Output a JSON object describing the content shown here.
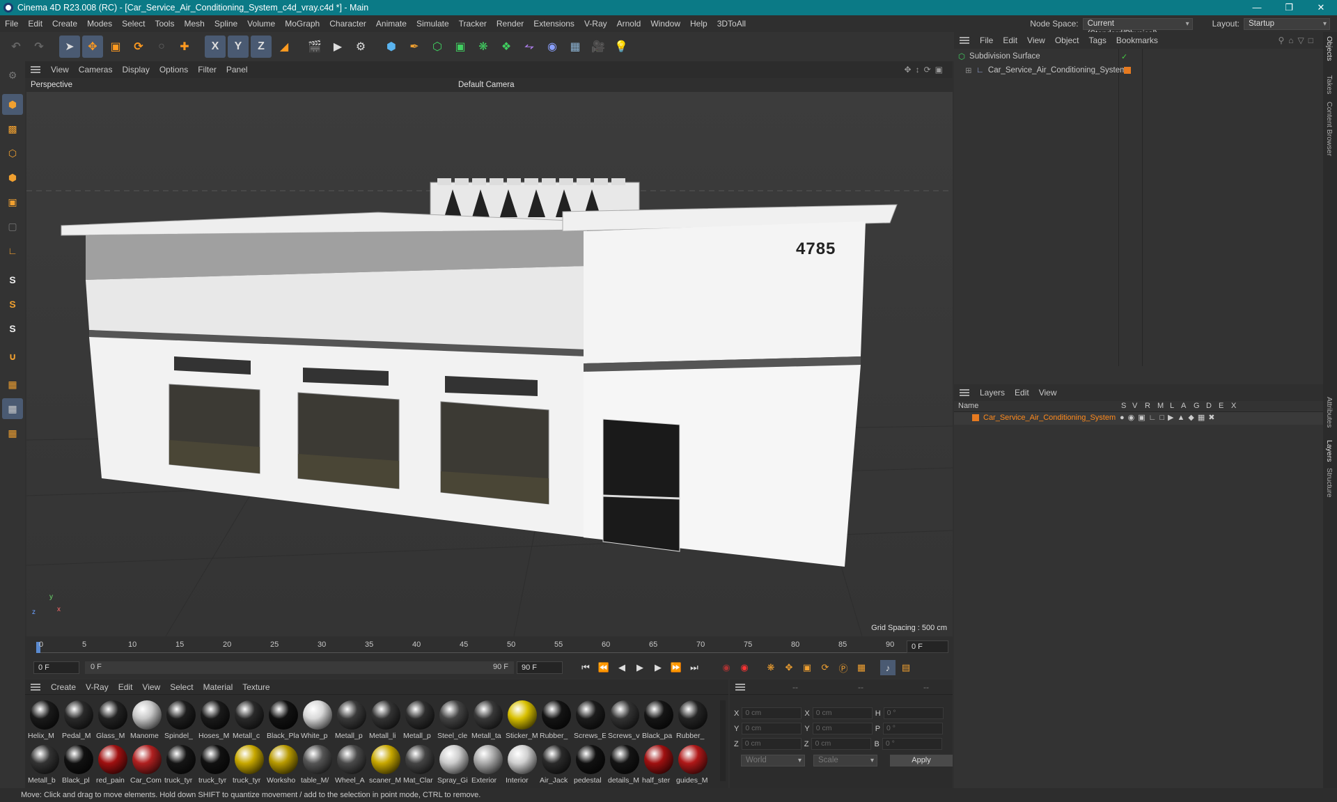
{
  "window": {
    "title": "Cinema 4D R23.008 (RC) - [Car_Service_Air_Conditioning_System_c4d_vray.c4d *] - Main"
  },
  "menubar": {
    "items": [
      "File",
      "Edit",
      "Create",
      "Modes",
      "Select",
      "Tools",
      "Mesh",
      "Spline",
      "Volume",
      "MoGraph",
      "Character",
      "Animate",
      "Simulate",
      "Tracker",
      "Render",
      "Extensions",
      "V-Ray",
      "Arnold",
      "Window",
      "Help",
      "3DToAll"
    ],
    "node_space_label": "Node Space:",
    "node_space_value": "Current (Standard/Physical)",
    "layout_label": "Layout:",
    "layout_value": "Startup"
  },
  "toolbar": {
    "axis_x": "X",
    "axis_y": "Y",
    "axis_z": "Z"
  },
  "left_tools": {
    "s1": "S",
    "s2": "S",
    "s3": "S"
  },
  "viewport": {
    "menu": [
      "View",
      "Cameras",
      "Display",
      "Options",
      "Filter",
      "Panel"
    ],
    "view_name": "Perspective",
    "camera": "Default Camera",
    "grid_spacing": "Grid Spacing : 500 cm",
    "building_number": "4785",
    "axis_y": "y",
    "axis_z": "z",
    "axis_x": "x"
  },
  "timeline": {
    "ticks": [
      "0",
      "5",
      "10",
      "15",
      "20",
      "25",
      "30",
      "35",
      "40",
      "45",
      "50",
      "55",
      "60",
      "65",
      "70",
      "75",
      "80",
      "85",
      "90"
    ],
    "current_frame": "0 F",
    "start": "0 F",
    "range_start": "0 F",
    "range_end": "90 F",
    "end": "90 F"
  },
  "materials": {
    "menu": [
      "Create",
      "V-Ray",
      "Edit",
      "View",
      "Select",
      "Material",
      "Texture"
    ],
    "row1": [
      {
        "name": "Helix_M",
        "color": "#1a1a1a"
      },
      {
        "name": "Pedal_M",
        "color": "#2a2a2a"
      },
      {
        "name": "Glass_M",
        "color": "#222"
      },
      {
        "name": "Manome",
        "color": "#c8c8c8"
      },
      {
        "name": "Spindel_",
        "color": "#1e1e1e"
      },
      {
        "name": "Hoses_M",
        "color": "#1a1a1a"
      },
      {
        "name": "Metall_c",
        "color": "#2a2a2a"
      },
      {
        "name": "Black_Pla",
        "color": "#111"
      },
      {
        "name": "White_p",
        "color": "#d8d8d8"
      },
      {
        "name": "Metall_p",
        "color": "#3a3a3a"
      },
      {
        "name": "Metall_li",
        "color": "#333"
      },
      {
        "name": "Metall_p",
        "color": "#2e2e2e"
      },
      {
        "name": "Steel_cle",
        "color": "#444"
      },
      {
        "name": "Metall_ta",
        "color": "#383838"
      },
      {
        "name": "Sticker_M",
        "color": "#d8c000"
      },
      {
        "name": "Rubber_",
        "color": "#141414"
      },
      {
        "name": "Screws_E",
        "color": "#1c1c1c"
      },
      {
        "name": "Screws_v",
        "color": "#333"
      },
      {
        "name": "Black_pa",
        "color": "#151515"
      },
      {
        "name": "Rubber_",
        "color": "#242424"
      }
    ],
    "row2": [
      {
        "name": "Metall_b",
        "color": "#333"
      },
      {
        "name": "Black_pl",
        "color": "#111"
      },
      {
        "name": "red_pain",
        "color": "#a01010"
      },
      {
        "name": "Car_Com",
        "color": "#b02020"
      },
      {
        "name": "truck_tyr",
        "color": "#151515"
      },
      {
        "name": "truck_tyr",
        "color": "#111"
      },
      {
        "name": "truck_tyr",
        "color": "#c8a800"
      },
      {
        "name": "Worksho",
        "color": "#b89a00"
      },
      {
        "name": "table_M/",
        "color": "#555"
      },
      {
        "name": "Wheel_A",
        "color": "#4a4a4a"
      },
      {
        "name": "scaner_M",
        "color": "#c8a800"
      },
      {
        "name": "Mat_Clar",
        "color": "#444"
      },
      {
        "name": "Spray_Gi",
        "color": "#ccc"
      },
      {
        "name": "Exterior",
        "color": "#aaa"
      },
      {
        "name": "Interior",
        "color": "#d0d0d0"
      },
      {
        "name": "Air_Jack",
        "color": "#2a2a2a"
      },
      {
        "name": "pedestal",
        "color": "#111"
      },
      {
        "name": "details_M",
        "color": "#141414"
      },
      {
        "name": "half_ster",
        "color": "#a01010"
      },
      {
        "name": "guides_M",
        "color": "#b01818"
      }
    ]
  },
  "coords": {
    "rows": [
      {
        "a": "X",
        "av": "0 cm",
        "b": "X",
        "bv": "0 cm",
        "c": "H",
        "cv": "0 °"
      },
      {
        "a": "Y",
        "av": "0 cm",
        "b": "Y",
        "bv": "0 cm",
        "c": "P",
        "cv": "0 °"
      },
      {
        "a": "Z",
        "av": "0 cm",
        "b": "Z",
        "bv": "0 cm",
        "c": "B",
        "cv": "0 °"
      }
    ],
    "header_dashes": [
      "--",
      "--",
      "--"
    ],
    "world": "World",
    "scale": "Scale",
    "apply": "Apply"
  },
  "objects": {
    "menu": [
      "File",
      "Edit",
      "View",
      "Object",
      "Tags",
      "Bookmarks"
    ],
    "items": [
      "Subdivision Surface",
      "Car_Service_Air_Conditioning_System"
    ]
  },
  "layers": {
    "menu": [
      "Layers",
      "Edit",
      "View"
    ],
    "col_name": "Name",
    "cols": [
      "S",
      "V",
      "R",
      "M",
      "L",
      "A",
      "G",
      "D",
      "E",
      "X"
    ],
    "item": "Car_Service_Air_Conditioning_System"
  },
  "side_tabs": [
    "Objects",
    "Takes",
    "Content Browser",
    "Attributes",
    "Layers",
    "Structure"
  ],
  "status": "Move: Click and drag to move elements. Hold down SHIFT to quantize movement / add to the selection in point mode, CTRL to remove."
}
